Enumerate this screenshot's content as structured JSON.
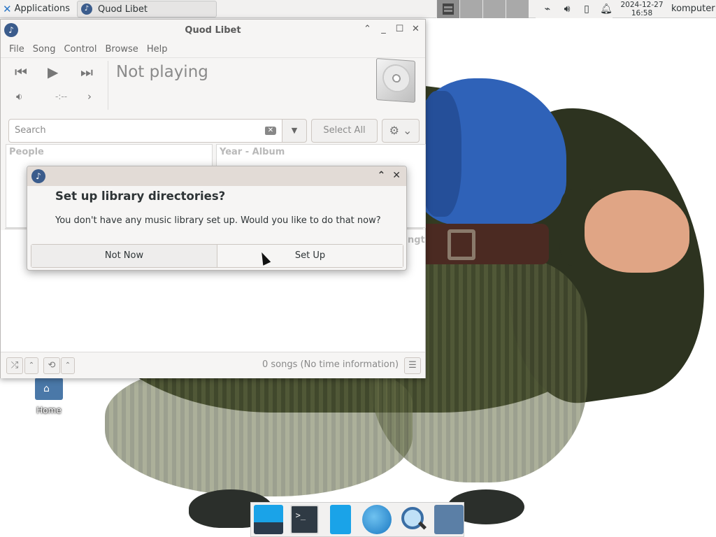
{
  "top_panel": {
    "applications_label": "Applications",
    "task_title": "Quod Libet",
    "clock_date": "2024-12-27",
    "clock_time": "16:58",
    "user": "komputer"
  },
  "window": {
    "title": "Quod Libet",
    "menu": [
      "File",
      "Song",
      "Control",
      "Browse",
      "Help"
    ],
    "status_heading": "Not playing",
    "time_display": "-:--",
    "search_placeholder": "Search",
    "select_all_label": "Select All",
    "pane_people_header": "People",
    "pane_album_header": "Year - Album",
    "length_header_fragment": "ngt",
    "status_text": "0 songs (No time information)"
  },
  "dialog": {
    "heading": "Set up library directories?",
    "body": "You don't have any music library set up. Would you like to do that now?",
    "not_now_label": "Not Now",
    "set_up_label": "Set Up"
  },
  "desktop": {
    "home_icon_label": "Home"
  },
  "icons": {
    "app_logo": "quodlibet-logo-icon",
    "prev": "skip-previous-icon",
    "play": "play-icon",
    "next": "skip-next-icon",
    "volume": "volume-icon",
    "album_art": "cd-case-icon",
    "gear": "gear-icon"
  },
  "colors": {
    "panel_bg": "#f2f1f0",
    "window_bg": "#f6f5f4",
    "dialog_titlebar": "#e2dbd6",
    "app_logo": "#3b5c8c",
    "accent_blue": "#1aa3e8"
  }
}
